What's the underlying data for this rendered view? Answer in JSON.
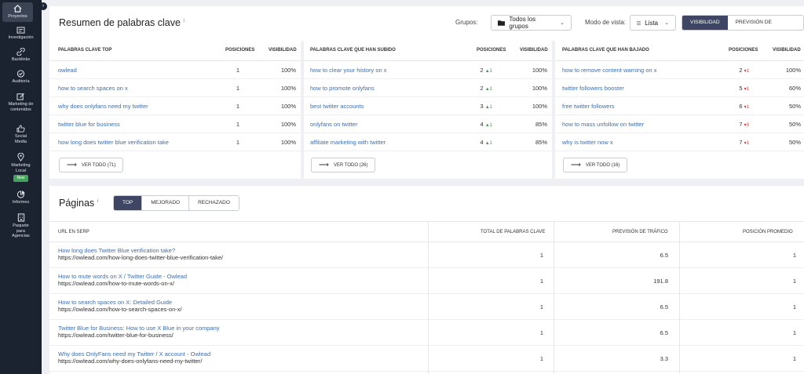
{
  "sidebar": {
    "items": [
      {
        "label": "Proyectos",
        "icon": "home-icon"
      },
      {
        "label": "Investigación",
        "icon": "research-icon"
      },
      {
        "label": "Backlinks",
        "icon": "link-icon"
      },
      {
        "label": "Auditoría",
        "icon": "audit-icon"
      },
      {
        "label": "Marketing de contenidos",
        "icon": "edit-icon"
      },
      {
        "label": "Social Media",
        "icon": "thumbs-up-icon"
      },
      {
        "label": "Marketing Local",
        "icon": "location-pin-icon",
        "badge": "New"
      },
      {
        "label": "Informes",
        "icon": "reports-icon"
      },
      {
        "label": "Paquete para Agencias",
        "icon": "building-icon"
      }
    ]
  },
  "summary": {
    "title": "Resumen de palabras clave",
    "info": "i",
    "groups_label": "Grupos:",
    "groups_value": "Todos los grupos",
    "view_label": "Modo de vista:",
    "view_value": "Lista",
    "seg_visibility": "VISIBILIDAD",
    "seg_traffic": "PREVISIÓN DE TRÁFICO"
  },
  "columns": [
    {
      "header": "PALABRAS CLAVE TOP",
      "pos_header": "POSICIONES",
      "vis_header": "VISIBILIDAD",
      "rows": [
        {
          "kw": "owlead",
          "pos": "1",
          "change": "",
          "dir": "",
          "vis": "100%"
        },
        {
          "kw": "how to search spaces on x",
          "pos": "1",
          "change": "",
          "dir": "",
          "vis": "100%"
        },
        {
          "kw": "why does onlyfans need my twitter",
          "pos": "1",
          "change": "",
          "dir": "",
          "vis": "100%"
        },
        {
          "kw": "twitter blue for business",
          "pos": "1",
          "change": "",
          "dir": "",
          "vis": "100%"
        },
        {
          "kw": "how long does twitter blue verification take",
          "pos": "1",
          "change": "",
          "dir": "",
          "vis": "100%"
        }
      ],
      "button": "VER TODO (71)"
    },
    {
      "header": "PALABRAS CLAVE QUE HAN SUBIDO",
      "pos_header": "POSICIONES",
      "vis_header": "VISIBILIDAD",
      "rows": [
        {
          "kw": "how to clear your history on x",
          "pos": "2",
          "change": "▲1",
          "dir": "up",
          "vis": "100%"
        },
        {
          "kw": "how to promote onlyfans",
          "pos": "2",
          "change": "▲1",
          "dir": "up",
          "vis": "100%"
        },
        {
          "kw": "best twitter accounts",
          "pos": "3",
          "change": "▲1",
          "dir": "up",
          "vis": "100%"
        },
        {
          "kw": "onlyfans on twitter",
          "pos": "4",
          "change": "▲1",
          "dir": "up",
          "vis": "85%"
        },
        {
          "kw": "affiliate marketing with twitter",
          "pos": "4",
          "change": "▲1",
          "dir": "up",
          "vis": "85%"
        }
      ],
      "button": "VER TODO (26)"
    },
    {
      "header": "PALABRAS CLAVE QUE HAN BAJADO",
      "pos_header": "POSICIONES",
      "vis_header": "VISIBILIDAD",
      "rows": [
        {
          "kw": "how to remove content warning on x",
          "pos": "2",
          "change": "▾1",
          "dir": "down",
          "vis": "100%"
        },
        {
          "kw": "twitter followers booster",
          "pos": "5",
          "change": "▾1",
          "dir": "down",
          "vis": "60%"
        },
        {
          "kw": "free twitter followers",
          "pos": "6",
          "change": "▾1",
          "dir": "down",
          "vis": "50%"
        },
        {
          "kw": "how to mass unfollow on twitter",
          "pos": "7",
          "change": "▾3",
          "dir": "down",
          "vis": "50%"
        },
        {
          "kw": "why is twitter now x",
          "pos": "7",
          "change": "▾1",
          "dir": "down",
          "vis": "50%"
        }
      ],
      "button": "VER TODO (16)"
    }
  ],
  "pages": {
    "title": "Páginas",
    "info": "i",
    "tabs": [
      "TOP",
      "MEJORADO",
      "RECHAZADO"
    ],
    "headers": {
      "url": "URL EN SERP",
      "total": "TOTAL DE PALABRAS CLAVE",
      "traffic": "PREVISIÓN DE TRÁFICO",
      "avg": "POSICIÓN PROMEDIO"
    },
    "rows": [
      {
        "title": "How long does Twitter Blue verification take?",
        "url": "https://owlead.com/how-long-does-twitter-blue-verification-take/",
        "total": "1",
        "traffic": "6.5",
        "avg": "1"
      },
      {
        "title": "How to mute words on X / Twitter Guide - Owlead",
        "url": "https://owlead.com/how-to-mute-words-on-x/",
        "total": "1",
        "traffic": "191.8",
        "avg": "1"
      },
      {
        "title": "How to search spaces on X: Detailed Guide",
        "url": "https://owlead.com/how-to-search-spaces-on-x/",
        "total": "1",
        "traffic": "6.5",
        "avg": "1"
      },
      {
        "title": "Twitter Blue for Business: How to use X Blue in your company",
        "url": "https://owlead.com/twitter-blue-for-business/",
        "total": "1",
        "traffic": "6.5",
        "avg": "1"
      },
      {
        "title": "Why does OnlyFans need my Twitter / X account - Owlead",
        "url": "https://owlead.com/why-does-onlyfans-need-my-twitter/",
        "total": "1",
        "traffic": "3.3",
        "avg": "1"
      }
    ]
  }
}
